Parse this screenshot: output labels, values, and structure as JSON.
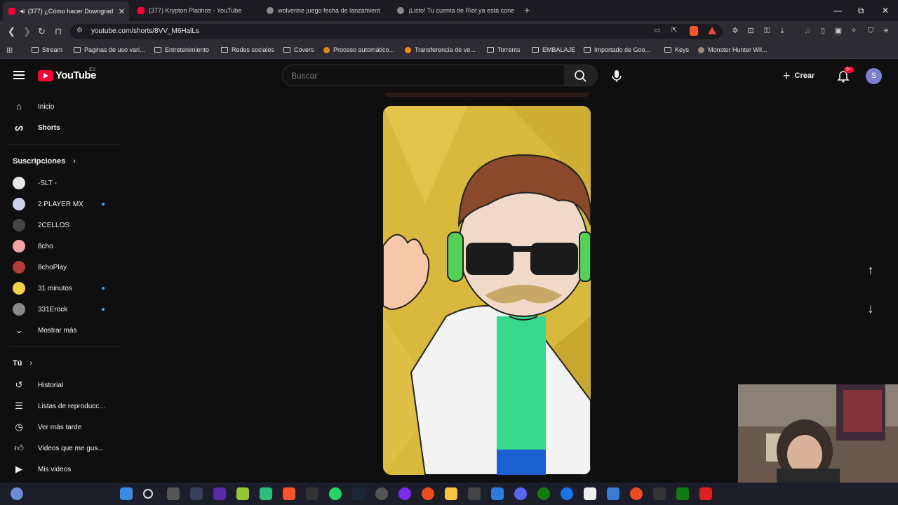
{
  "browser": {
    "tabs": [
      {
        "title": "(377) ¿Cómo hacer Downgrad",
        "active": true
      },
      {
        "title": "(377) Krypton Platinos - YouTube",
        "active": false
      },
      {
        "title": "wolverine juego fecha de lanzamient",
        "active": false
      },
      {
        "title": "¡Listo! Tu cuenta de Riot ya está cone",
        "active": false
      }
    ],
    "new_tab_label": "+",
    "url": "youtube.com/shorts/8VV_M6HalLs",
    "bookmarks": [
      {
        "label": "Stream",
        "type": "folder"
      },
      {
        "label": "Paginas de uso vari...",
        "type": "folder"
      },
      {
        "label": "Entretenimiento",
        "type": "folder"
      },
      {
        "label": "Redes sociales",
        "type": "folder"
      },
      {
        "label": "Covers",
        "type": "folder"
      },
      {
        "label": "Proceso automático...",
        "type": "site"
      },
      {
        "label": "Transferencia de ve...",
        "type": "site"
      },
      {
        "label": "Torrents",
        "type": "folder"
      },
      {
        "label": "EMBALAJE",
        "type": "folder"
      },
      {
        "label": "Importado de Goo...",
        "type": "folder"
      },
      {
        "label": "Keys",
        "type": "folder"
      },
      {
        "label": "Monster Hunter Wil...",
        "type": "site"
      }
    ]
  },
  "youtube": {
    "logo_text": "YouTube",
    "country_code": "ES",
    "search_placeholder": "Buscar",
    "create_label": "Crear",
    "notifications_badge": "9+",
    "avatar_letter": "S",
    "sidebar": {
      "primary": [
        {
          "label": "Inicio",
          "icon": "home-icon"
        },
        {
          "label": "Shorts",
          "icon": "shorts-icon"
        }
      ],
      "subscriptions_heading": "Suscripciones",
      "subscriptions": [
        {
          "label": "-SLT -",
          "new": false,
          "color": "#e8e8e8"
        },
        {
          "label": "2 PLAYER MX",
          "new": true,
          "color": "#c9d2e6"
        },
        {
          "label": "2CELLOS",
          "new": false,
          "color": "#444444"
        },
        {
          "label": "8cho",
          "new": false,
          "color": "#f4a3a3"
        },
        {
          "label": "8choPlay",
          "new": false,
          "color": "#b23a3a"
        },
        {
          "label": "31 minutos",
          "new": true,
          "color": "#f3d24a"
        },
        {
          "label": "331Erock",
          "new": true,
          "color": "#8a8a8a"
        }
      ],
      "show_more_label": "Mostrar más",
      "you_heading": "Tú",
      "you_items": [
        {
          "label": "Historial",
          "icon": "history-icon"
        },
        {
          "label": "Listas de reproducc...",
          "icon": "playlists-icon"
        },
        {
          "label": "Ver más tarde",
          "icon": "watch-later-icon"
        },
        {
          "label": "Videos que me gus...",
          "icon": "like-icon"
        },
        {
          "label": "Mis videos",
          "icon": "my-videos-icon"
        }
      ]
    }
  },
  "colors": {
    "yt_red": "#ff0033",
    "background": "#0f0f0f",
    "short_bg": "#d9b93b"
  }
}
